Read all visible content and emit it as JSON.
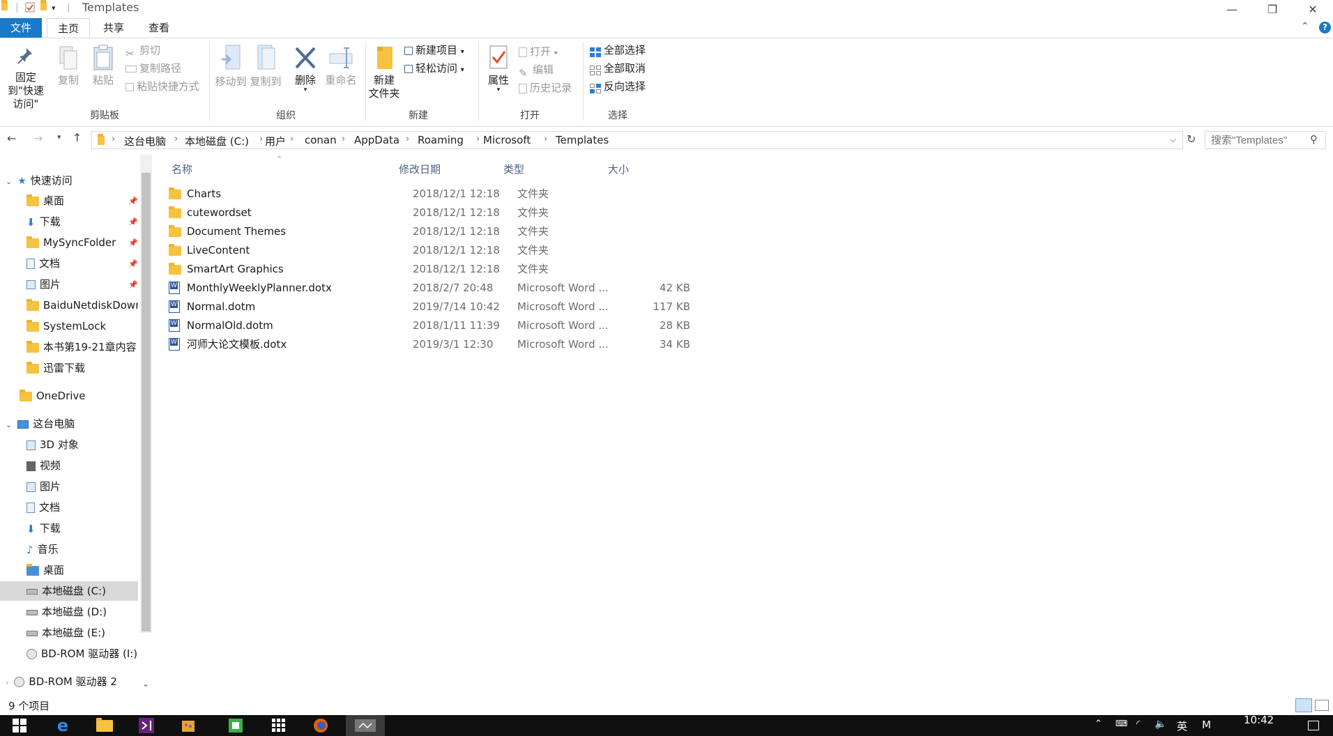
{
  "window": {
    "title": "Templates",
    "minimize": "—",
    "restore": "❐",
    "close": "✕"
  },
  "ribbon_tabs": {
    "file": "文件",
    "home": "主页",
    "share": "共享",
    "view": "查看"
  },
  "ribbon": {
    "pin_quick": "固定到\"快速访问\"",
    "copy": "复制",
    "paste": "粘贴",
    "cut": "剪切",
    "copy_path": "复制路径",
    "paste_shortcut": "粘贴快捷方式",
    "move_to": "移动到",
    "copy_to": "复制到",
    "delete": "删除",
    "rename": "重命名",
    "new_folder": "新建\n文件夹",
    "new_item": "新建项目",
    "easy_access": "轻松访问",
    "properties": "属性",
    "open": "打开",
    "edit": "编辑",
    "history": "历史记录",
    "select_all": "全部选择",
    "select_none": "全部取消",
    "invert_selection": "反向选择",
    "groups": {
      "clipboard": "剪贴板",
      "organize": "组织",
      "new": "新建",
      "open": "打开",
      "select": "选择"
    }
  },
  "address": {
    "crumbs": [
      "这台电脑",
      "本地磁盘 (C:)",
      "用户",
      "conan",
      "AppData",
      "Roaming",
      "Microsoft",
      "Templates"
    ],
    "search_placeholder": "搜索\"Templates\""
  },
  "nav": {
    "quick_access": "快速访问",
    "quick_items": [
      "桌面",
      "下载",
      "MySyncFolder",
      "文档",
      "图片",
      "BaiduNetdiskDownload",
      "SystemLock",
      "本书第19-21章内容",
      "迅雷下载"
    ],
    "onedrive": "OneDrive",
    "this_pc": "这台电脑",
    "pc_items": [
      "3D 对象",
      "视频",
      "图片",
      "文档",
      "下载",
      "音乐",
      "桌面",
      "本地磁盘 (C:)",
      "本地磁盘 (D:)",
      "本地磁盘 (E:)",
      "BD-ROM 驱动器 (I:)"
    ],
    "bd_rom2": "BD-ROM 驱动器 2"
  },
  "list": {
    "headers": {
      "name": "名称",
      "date": "修改日期",
      "type": "类型",
      "size": "大小"
    },
    "rows": [
      {
        "name": "Charts",
        "date": "2018/12/1 12:18",
        "type": "文件夹",
        "size": "",
        "kind": "folder"
      },
      {
        "name": "cutewordset",
        "date": "2018/12/1 12:18",
        "type": "文件夹",
        "size": "",
        "kind": "folder"
      },
      {
        "name": "Document Themes",
        "date": "2018/12/1 12:18",
        "type": "文件夹",
        "size": "",
        "kind": "folder"
      },
      {
        "name": "LiveContent",
        "date": "2018/12/1 12:18",
        "type": "文件夹",
        "size": "",
        "kind": "folder"
      },
      {
        "name": "SmartArt Graphics",
        "date": "2018/12/1 12:18",
        "type": "文件夹",
        "size": "",
        "kind": "folder"
      },
      {
        "name": "MonthlyWeeklyPlanner.dotx",
        "date": "2018/2/7 20:48",
        "type": "Microsoft Word ...",
        "size": "42 KB",
        "kind": "word"
      },
      {
        "name": "Normal.dotm",
        "date": "2019/7/14 10:42",
        "type": "Microsoft Word ...",
        "size": "117 KB",
        "kind": "word"
      },
      {
        "name": "NormalOld.dotm",
        "date": "2018/1/11 11:39",
        "type": "Microsoft Word ...",
        "size": "28 KB",
        "kind": "word"
      },
      {
        "name": "河师大论文模板.dotx",
        "date": "2019/3/1 12:30",
        "type": "Microsoft Word ...",
        "size": "34 KB",
        "kind": "word"
      }
    ]
  },
  "status": {
    "count": "9 个项目"
  },
  "taskbar": {
    "time": "10:42",
    "ime": "英",
    "ime2": "M"
  }
}
